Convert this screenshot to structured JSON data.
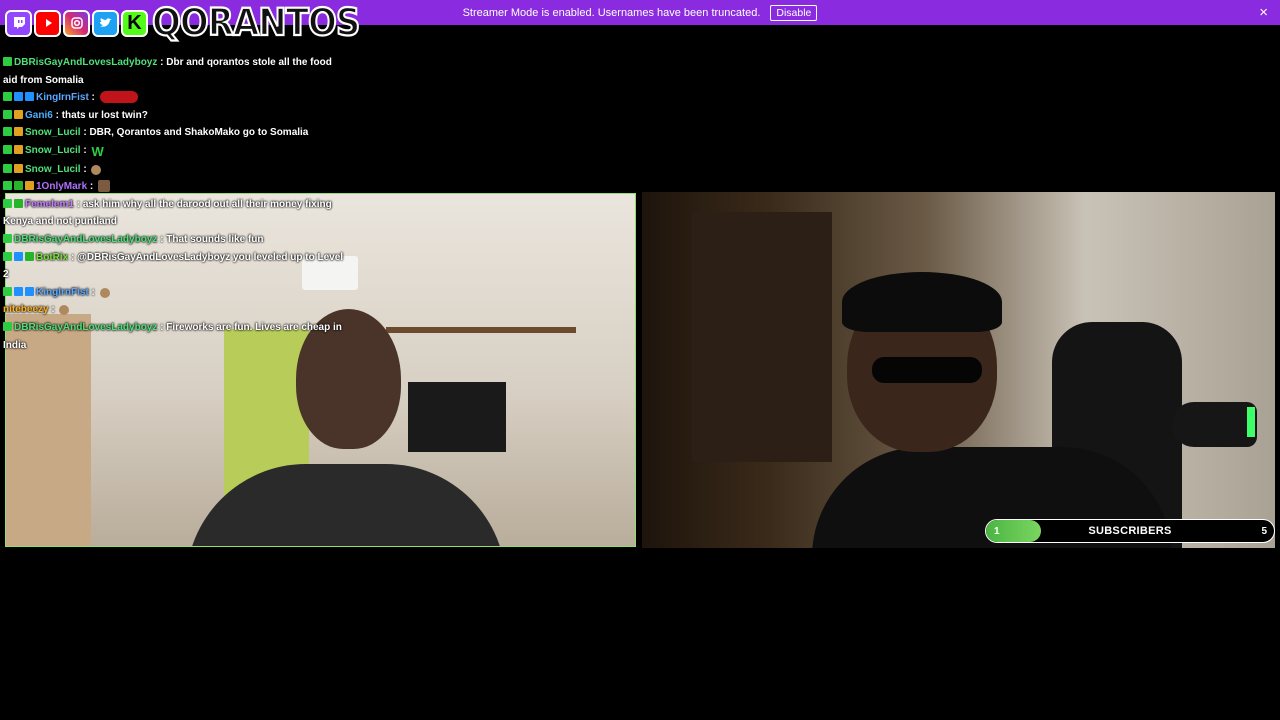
{
  "banner": {
    "message": "Streamer Mode is enabled. Usernames have been truncated.",
    "disable_label": "Disable",
    "close_icon": "×"
  },
  "logo": {
    "icons": [
      "twitch-icon",
      "youtube-icon",
      "instagram-icon",
      "twitter-icon",
      "kick-icon"
    ],
    "brand_text": "QORANTOS"
  },
  "chat": {
    "messages": [
      {
        "user": "DBRisGayAndLovesLadyboyz",
        "user_color": "#4fe07a",
        "text": "Dbr and qorantos stole all the food aid from Somalia"
      },
      {
        "user": "KingIrnFist",
        "user_color": "#5aa8ff",
        "text": ""
      },
      {
        "user": "Gani6",
        "user_color": "#4fb0ff",
        "text": "thats ur lost twin?"
      },
      {
        "user": "Snow_Lucil",
        "user_color": "#4fe07a",
        "text": "DBR, Qorantos and ShakoMako go to Somalia"
      },
      {
        "user": "Snow_Lucil",
        "user_color": "#4fe07a",
        "text": ""
      },
      {
        "user": "Snow_Lucil",
        "user_color": "#4fe07a",
        "text": ""
      },
      {
        "user": "1OnlyMark",
        "user_color": "#b070ff",
        "text": ""
      },
      {
        "user": "Femelem1",
        "user_color": "#c77dff",
        "text": "ask him why all the darood out all their money fixing Kenya and not puntland"
      },
      {
        "user": "DBRisGayAndLovesLadyboyz",
        "user_color": "#4fe07a",
        "text": "That sounds like fun"
      },
      {
        "user": "BotRix",
        "user_color": "#7be040",
        "text": "@DBRisGayAndLovesLadyboyz you leveled up to Level 2"
      },
      {
        "user": "KingIrnFist",
        "user_color": "#5aa8ff",
        "text": ""
      },
      {
        "user": "nitebeezy",
        "user_color": "#ffb020",
        "text": ""
      },
      {
        "user": "DBRisGayAndLovesLadyboyz",
        "user_color": "#4fe07a",
        "text": "Fireworks are fun. Lives are cheap in India"
      }
    ],
    "separator": ":"
  },
  "goal": {
    "start": "1",
    "label": "SUBSCRIBERS",
    "end": "5",
    "progress": 0.19
  }
}
